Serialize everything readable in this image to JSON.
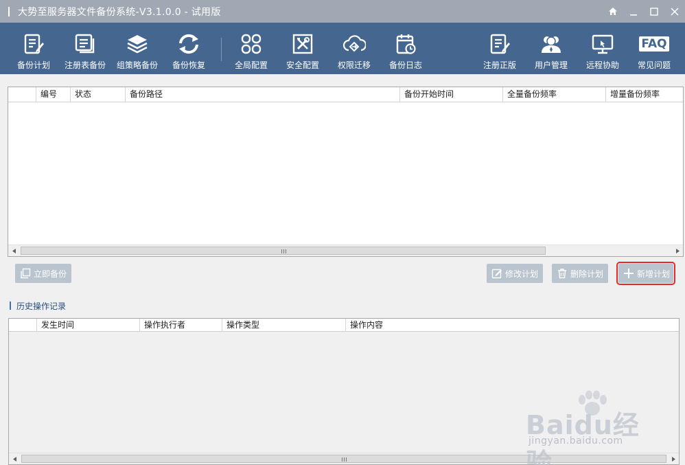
{
  "window": {
    "title": "大势至服务器文件备份系统-V3.1.0.0 - 试用版"
  },
  "toolbar": {
    "items": [
      {
        "label": "备份计划",
        "icon": "plan-edit-icon"
      },
      {
        "label": "注册表备份",
        "icon": "registry-docs-icon"
      },
      {
        "label": "组策略备份",
        "icon": "layers-icon"
      },
      {
        "label": "备份恢复",
        "icon": "refresh-icon"
      },
      {
        "label": "全局配置",
        "icon": "grid-settings-icon"
      },
      {
        "label": "安全配置",
        "icon": "tools-icon"
      },
      {
        "label": "权限迁移",
        "icon": "cloud-transfer-icon"
      },
      {
        "label": "备份日志",
        "icon": "calendar-clock-icon"
      },
      {
        "label": "注册正版",
        "icon": "register-edit-icon"
      },
      {
        "label": "用户管理",
        "icon": "users-icon"
      },
      {
        "label": "远程协助",
        "icon": "remote-monitor-icon"
      },
      {
        "label": "常见问题",
        "icon": "faq-icon"
      }
    ],
    "faq_text": "FAQ"
  },
  "plan_table": {
    "columns": [
      "编号",
      "状态",
      "备份路径",
      "备份开始时间",
      "全量备份频率",
      "增量备份频率"
    ],
    "rows": []
  },
  "actions": {
    "backup_now": "立即备份",
    "modify_plan": "修改计划",
    "delete_plan": "删除计划",
    "add_plan": "新增计划"
  },
  "history": {
    "title": "历史操作记录",
    "columns": [
      "发生时间",
      "操作执行者",
      "操作类型",
      "操作内容"
    ],
    "rows": []
  },
  "watermark": {
    "logo": "Baidu经验",
    "url": "jingyan.baidu.com"
  },
  "colors": {
    "titlebar": "#a0a9b3",
    "toolbar": "#44668f",
    "button": "#b9c4cf",
    "highlight": "#e8262b",
    "section_text": "#274e7e"
  }
}
